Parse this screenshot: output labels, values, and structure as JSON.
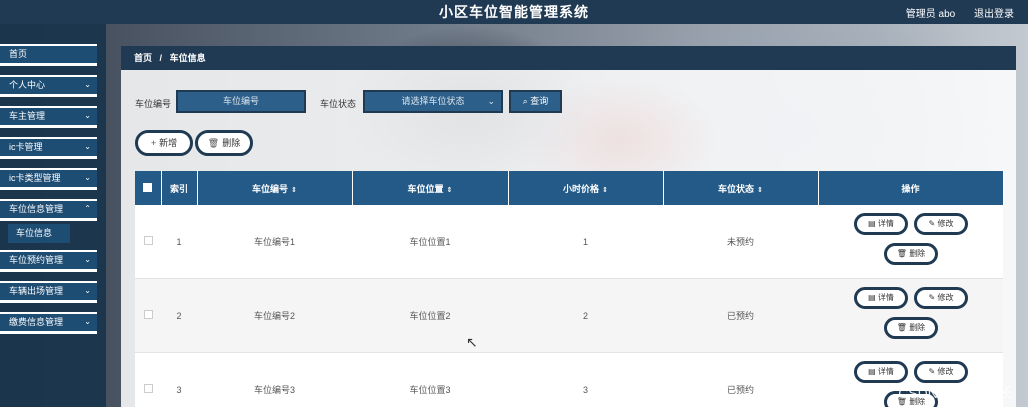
{
  "app": {
    "title": "小区车位智能管理系统",
    "user": "管理员 abo",
    "logout": "退出登录"
  },
  "sidebar": {
    "items": [
      {
        "label": "首页",
        "chevron": ""
      },
      {
        "label": "个人中心",
        "chevron": "⌄"
      },
      {
        "label": "车主管理",
        "chevron": "⌄"
      },
      {
        "label": "ic卡管理",
        "chevron": "⌄"
      },
      {
        "label": "ic卡类型管理",
        "chevron": "⌄"
      },
      {
        "label": "车位信息管理",
        "chevron": "⌃"
      },
      {
        "label": "车位预约管理",
        "chevron": "⌄"
      },
      {
        "label": "车辆出场管理",
        "chevron": "⌄"
      },
      {
        "label": "缴费信息管理",
        "chevron": "⌄"
      }
    ],
    "sub_active": "车位信息"
  },
  "breadcrumb": {
    "home": "首页",
    "sep": "/",
    "current": "车位信息"
  },
  "search": {
    "number_label": "车位编号",
    "number_placeholder": "车位编号",
    "status_label": "车位状态",
    "status_placeholder": "请选择车位状态",
    "search_button": "查询"
  },
  "actions": {
    "add": "新增",
    "delete": "删除"
  },
  "table": {
    "columns": [
      "索引",
      "车位编号",
      "车位位置",
      "小时价格",
      "车位状态",
      "操作"
    ],
    "sort_glyph": "⇕",
    "rows": [
      {
        "index": "1",
        "number": "车位编号1",
        "location": "车位位置1",
        "price": "1",
        "status": "未预约"
      },
      {
        "index": "2",
        "number": "车位编号2",
        "location": "车位位置2",
        "price": "2",
        "status": "已预约"
      },
      {
        "index": "3",
        "number": "车位编号3",
        "location": "车位位置3",
        "price": "3",
        "status": "已预约"
      }
    ],
    "op_detail": "详情",
    "op_edit": "修改",
    "op_delete": "删除"
  },
  "watermark": "CSDN @战少学长",
  "colors": {
    "primary": "#1f3a52",
    "accent": "#245a87"
  }
}
